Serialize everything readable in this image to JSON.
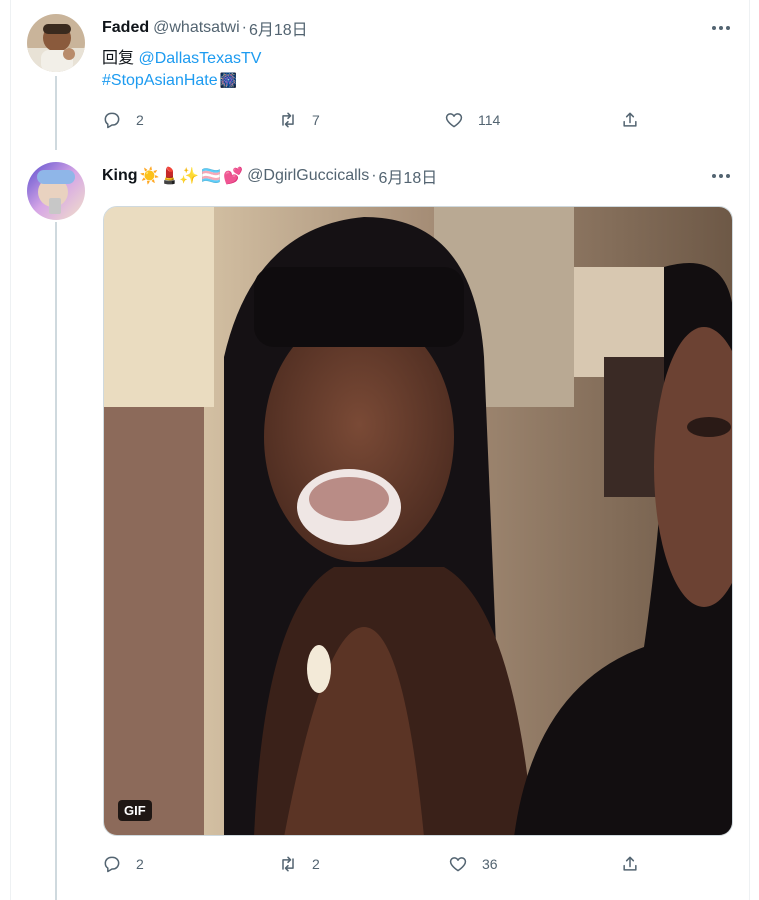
{
  "tweets": [
    {
      "name": "Faded",
      "handle": "@whatsatwi",
      "separator": "·",
      "date": "6月18日",
      "reply_prefix": "回复",
      "reply_to": "@DallasTexasTV",
      "hashtag": "#StopAsianHate",
      "hashtag_emoji": "🎆",
      "reply_count": "2",
      "retweet_count": "7",
      "like_count": "114"
    },
    {
      "name": "King",
      "name_emojis": "☀️💄✨",
      "flag_emoji": "🏳️‍⚧️",
      "heart_emoji": "💕",
      "handle": "@DgirlGuccicalls",
      "separator": "·",
      "date": "6月18日",
      "media_badge": "GIF",
      "reply_count": "2",
      "retweet_count": "2",
      "like_count": "36"
    }
  ],
  "colors": {
    "link": "#1d9bf0",
    "secondary_text": "#536471",
    "thread_line": "#cfd9de"
  },
  "icons": [
    "more-icon",
    "reply-icon",
    "retweet-icon",
    "like-icon",
    "share-icon"
  ]
}
